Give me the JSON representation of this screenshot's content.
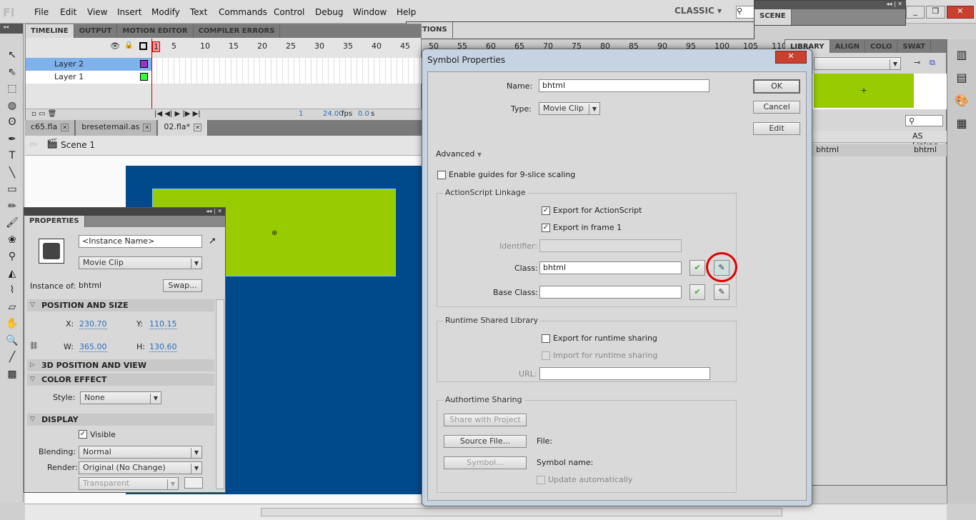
{
  "app": {
    "logo": "Fl",
    "workspace": "CLASSIC"
  },
  "menu": [
    "File",
    "Edit",
    "View",
    "Insert",
    "Modify",
    "Text",
    "Commands",
    "Control",
    "Debug",
    "Window",
    "Help"
  ],
  "timeline": {
    "tabs": [
      "TIMELINE",
      "OUTPUT",
      "MOTION EDITOR",
      "COMPILER ERRORS"
    ],
    "frame_numbers": [
      "1",
      "5",
      "10",
      "15",
      "20",
      "25",
      "30",
      "35",
      "40",
      "45",
      "50",
      "55",
      "60",
      "65",
      "70",
      "75",
      "80",
      "85",
      "90",
      "95",
      "100",
      "105",
      "110"
    ],
    "layers": [
      {
        "name": "Layer 2",
        "color": "#9933cc",
        "selected": true
      },
      {
        "name": "Layer 1",
        "color": "#33ff33",
        "selected": false
      }
    ],
    "current_frame": "1",
    "fps": "24.00",
    "fps_unit": "fps",
    "time": "0.0",
    "time_unit": "s"
  },
  "doc_tabs": [
    {
      "label": "c65.fla",
      "active": false
    },
    {
      "label": "bresetemail.as",
      "active": false
    },
    {
      "label": "02.fla*",
      "active": true
    }
  ],
  "scene": {
    "label": "Scene 1"
  },
  "stage": {
    "bg_color": "#004a8b",
    "clip_color": "#99cc00"
  },
  "actions_panel": {
    "title": "ACTIONS"
  },
  "scene_panel": {
    "title": "SCENE"
  },
  "library": {
    "tabs": [
      "LIBRARY",
      "ALIGN",
      "COLO",
      "SWAT"
    ],
    "col_linkage": "AS Linkag",
    "items": [
      {
        "name": "bhtml",
        "linkage": "bhtml"
      }
    ]
  },
  "properties": {
    "title": "PROPERTIES",
    "instance_name_placeholder": "<Instance Name>",
    "type": "Movie Clip",
    "instance_of_label": "Instance of:",
    "instance_of": "bhtml",
    "swap": "Swap...",
    "sections": {
      "position": "POSITION AND SIZE",
      "3d": "3D POSITION AND VIEW",
      "color": "COLOR EFFECT",
      "display": "DISPLAY"
    },
    "x_label": "X:",
    "x": "230.70",
    "y_label": "Y:",
    "y": "110.15",
    "w_label": "W:",
    "w": "365.00",
    "h_label": "H:",
    "h": "130.60",
    "style_label": "Style:",
    "style": "None",
    "visible_label": "Visible",
    "blending_label": "Blending:",
    "blending": "Normal",
    "render_label": "Render:",
    "render": "Original (No Change)",
    "transparent": "Transparent"
  },
  "dialog": {
    "title": "Symbol Properties",
    "name_label": "Name:",
    "name": "bhtml",
    "type_label": "Type:",
    "type": "Movie Clip",
    "ok": "OK",
    "cancel": "Cancel",
    "edit": "Edit",
    "advanced": "Advanced",
    "nine_slice": "Enable guides for 9-slice scaling",
    "linkage": {
      "title": "ActionScript Linkage",
      "export_as": "Export for ActionScript",
      "export_frame1": "Export in frame 1",
      "identifier_label": "Identifier:",
      "class_label": "Class:",
      "class": "bhtml",
      "base_class_label": "Base Class:",
      "base_class": ""
    },
    "rsl": {
      "title": "Runtime Shared Library",
      "export_runtime": "Export for runtime sharing",
      "import_runtime": "Import for runtime sharing",
      "url_label": "URL:"
    },
    "authortime": {
      "title": "Authortime Sharing",
      "share": "Share with Project",
      "source": "Source File...",
      "file_label": "File:",
      "symbol": "Symbol...",
      "symbol_name_label": "Symbol name:",
      "update": "Update automatically"
    },
    "highlight_color": "#e00000"
  }
}
